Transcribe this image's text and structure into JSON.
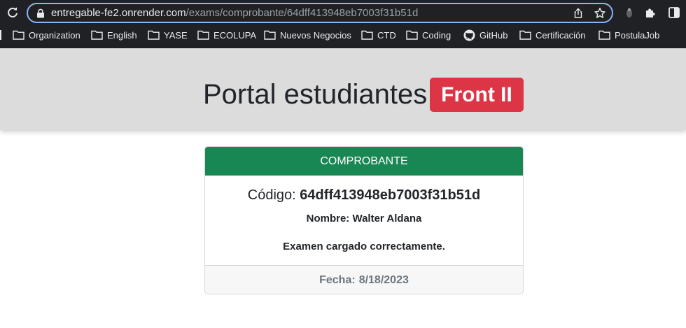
{
  "browser": {
    "url_host": "entregable-fe2.onrender.com",
    "url_path": "/exams/comprobante/64dff413948eb7003f31b51d",
    "bookmarks": [
      {
        "label": "Organization",
        "icon": "folder-icon"
      },
      {
        "label": "English",
        "icon": "folder-icon"
      },
      {
        "label": "YASE",
        "icon": "folder-icon"
      },
      {
        "label": "ECOLUPA",
        "icon": "folder-icon"
      },
      {
        "label": "Nuevos Negocios",
        "icon": "folder-icon"
      },
      {
        "label": "CTD",
        "icon": "folder-icon"
      },
      {
        "label": "Coding",
        "icon": "folder-icon"
      },
      {
        "label": "GitHub",
        "icon": "github-icon"
      },
      {
        "label": "Certificación",
        "icon": "folder-icon"
      },
      {
        "label": "PostulaJob",
        "icon": "folder-icon"
      }
    ]
  },
  "header": {
    "title": "Portal estudiantes",
    "badge": "Front II",
    "badge_color": "#dc3545"
  },
  "card": {
    "header_label": "COMPROBANTE",
    "header_color": "#198754",
    "code_label": "Código:",
    "code_value": "64dff413948eb7003f31b51d",
    "name_label": "Nombre:",
    "name_value": "Walter Aldana",
    "message": "Examen cargado correctamente.",
    "date_label": "Fecha:",
    "date_value": "8/18/2023"
  }
}
